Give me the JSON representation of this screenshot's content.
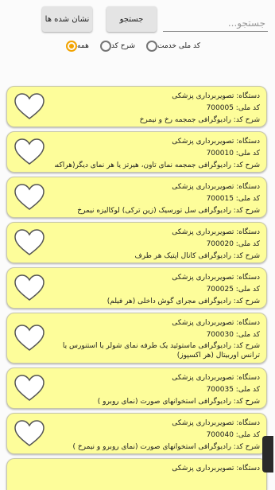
{
  "header": {
    "search_placeholder": "جستجو...",
    "search_button": "جستجو",
    "bookmarks_button": "نشان شده ها"
  },
  "filters": [
    {
      "label": "کد ملی خدمت",
      "selected": false
    },
    {
      "label": "شرح کد",
      "selected": false
    },
    {
      "label": "همه",
      "selected": true
    }
  ],
  "items": [
    {
      "device": "دستگاه: تصویربرداری پزشکی",
      "code": "کد ملی: 700005",
      "desc": "شرح کد: رادیوگرافی جمجمه رخ و نیمرخ"
    },
    {
      "device": "دستگاه: تصویربرداری پزشکی",
      "code": "کد ملی: 700010",
      "desc": "شرح کد: رادیوگرافی جمجمه نمای تاون، هیرتز یا هر نمای دیگر(هراکسپوز)"
    },
    {
      "device": "دستگاه: تصویربرداری پزشکی",
      "code": "کد ملی: 700015",
      "desc": "شرح کد: رادیوگرافی سل تورسیک (زین ترکی) لوکالیزه نیمرخ"
    },
    {
      "device": "دستگاه: تصویربرداری پزشکی",
      "code": "کد ملی: 700020",
      "desc": "شرح کد: رادیوگرافی کانال اپتیک هر طرف"
    },
    {
      "device": "دستگاه: تصویربرداری پزشکی",
      "code": "کد ملی: 700025",
      "desc": "شرح کد: رادیوگرافی مجرای گوش داخلی (هر فیلم)"
    },
    {
      "device": "دستگاه: تصویربرداری پزشکی",
      "code": "کد ملی: 700030",
      "desc": "شرح کد: رادیوگرافی ماستوئید یک طرفه نمای شولر یا استنورس یا ترانس اوربیتال (هر اکسپوز)"
    },
    {
      "device": "دستگاه: تصویربرداری پزشکی",
      "code": "کد ملی: 700035",
      "desc": "شرح کد: رادیوگرافی استخوانهای صورت (نمای روبرو )"
    },
    {
      "device": "دستگاه: تصویربرداری پزشکی",
      "code": "کد ملی: 700040",
      "desc": "شرح کد: رادیوگرافی استخوانهای صورت (نمای روبرو و نیمرخ )"
    },
    {
      "device": "دستگاه: تصویربرداری پزشکی",
      "code": "",
      "desc": ""
    }
  ],
  "colors": {
    "card": "#fdfd9a",
    "accent": "#f2a300"
  }
}
